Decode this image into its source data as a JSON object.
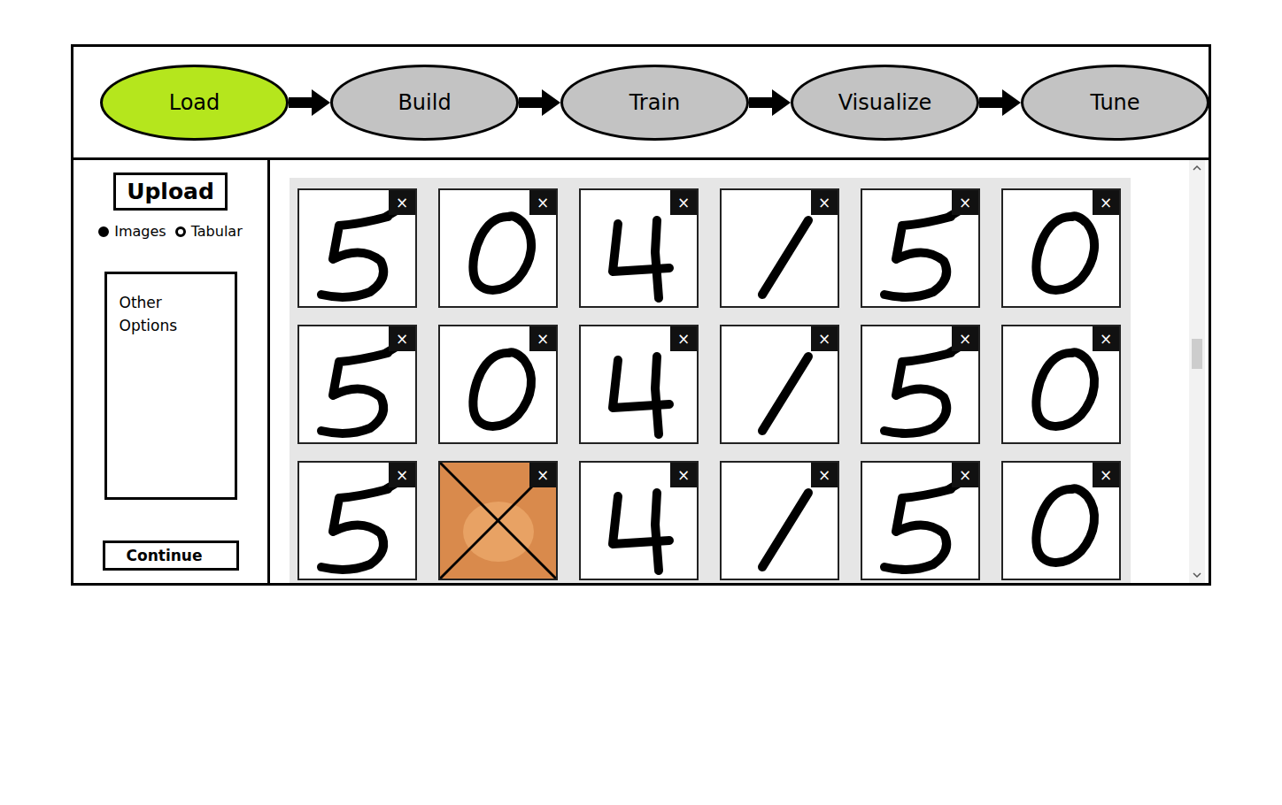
{
  "pipeline": [
    {
      "label": "Load",
      "selected": true
    },
    {
      "label": "Build",
      "selected": false
    },
    {
      "label": "Train",
      "selected": false
    },
    {
      "label": "Visualize",
      "selected": false
    },
    {
      "label": "Tune",
      "selected": false
    }
  ],
  "sidebar": {
    "upload": "Upload",
    "data_types": [
      {
        "label": "Images",
        "selected": true
      },
      {
        "label": "Tabular",
        "selected": false
      }
    ],
    "options_title": "Other Options",
    "continue": "Continue"
  },
  "gallery": {
    "tiles": [
      {
        "kind": "five",
        "excluded": false,
        "close": "×"
      },
      {
        "kind": "zero",
        "excluded": false,
        "close": "×"
      },
      {
        "kind": "four",
        "excluded": false,
        "close": "×"
      },
      {
        "kind": "one",
        "excluded": false,
        "close": "×"
      },
      {
        "kind": "five",
        "excluded": false,
        "close": "×"
      },
      {
        "kind": "zero",
        "excluded": false,
        "close": "×"
      },
      {
        "kind": "five",
        "excluded": false,
        "close": "×"
      },
      {
        "kind": "zero",
        "excluded": false,
        "close": "×"
      },
      {
        "kind": "four",
        "excluded": false,
        "close": "×"
      },
      {
        "kind": "one",
        "excluded": false,
        "close": "×"
      },
      {
        "kind": "five",
        "excluded": false,
        "close": "×"
      },
      {
        "kind": "zero",
        "excluded": false,
        "close": "×"
      },
      {
        "kind": "five",
        "excluded": false,
        "close": "×"
      },
      {
        "kind": "cat",
        "excluded": true,
        "close": "×"
      },
      {
        "kind": "four",
        "excluded": false,
        "close": "×"
      },
      {
        "kind": "one",
        "excluded": false,
        "close": "×"
      },
      {
        "kind": "five",
        "excluded": false,
        "close": "×"
      },
      {
        "kind": "zero",
        "excluded": false,
        "close": "×"
      }
    ]
  },
  "scrollbar": {
    "position": 0.45
  }
}
